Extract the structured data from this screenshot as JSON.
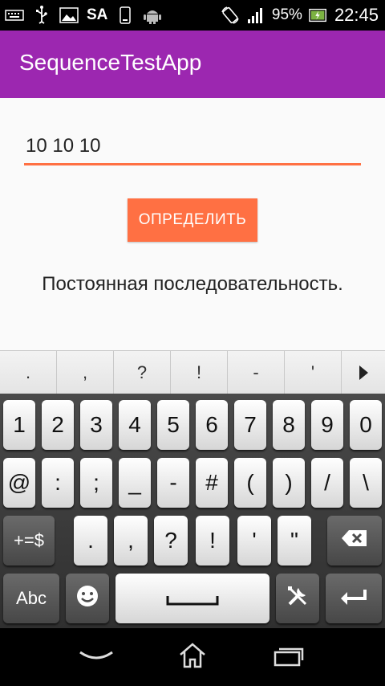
{
  "status_bar": {
    "carrier": "SA",
    "battery_percent": "95%",
    "time": "22:45",
    "icons_left": [
      "keyboard-icon",
      "usb-icon",
      "image-icon",
      "sim-icon",
      "phone-icon",
      "android-icon"
    ],
    "icons_right": [
      "rotate-icon",
      "signal-icon",
      "battery-icon"
    ]
  },
  "app_bar": {
    "title": "SequenceTestApp",
    "color": "#9c27b0"
  },
  "main": {
    "input_value": "10 10 10",
    "button_label": "ОПРЕДЕЛИТЬ",
    "result_text": "Постоянная последовательность.",
    "accent_color": "#ff7043"
  },
  "suggestions": [
    ".",
    ",",
    "?",
    "!",
    "-",
    "'"
  ],
  "keyboard": {
    "row1": [
      "1",
      "2",
      "3",
      "4",
      "5",
      "6",
      "7",
      "8",
      "9",
      "0"
    ],
    "row2": [
      "@",
      ":",
      ";",
      "_",
      "-",
      "#",
      "(",
      ")",
      "/",
      "\\"
    ],
    "row3": [
      ".",
      ",",
      "?",
      "!",
      "'",
      "\""
    ],
    "symbols_key": "+=$",
    "abc_key": "Abc"
  },
  "nav_bar": {
    "icons": [
      "back-icon",
      "home-icon",
      "recent-apps-icon"
    ]
  }
}
